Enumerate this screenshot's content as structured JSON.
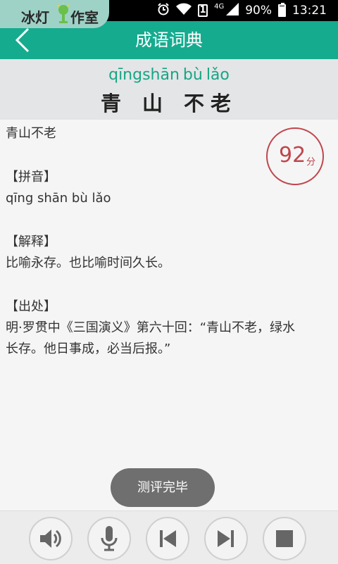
{
  "statusbar": {
    "watermark_left": "冰灯",
    "watermark_right": "作室",
    "network": "4G",
    "sim": "1",
    "battery": "90%",
    "time": "13:21"
  },
  "header": {
    "title": "成语词典"
  },
  "idiom": {
    "pinyin": "qīngshān bù lǎo",
    "chars_first": "青山",
    "chars_rest": "不老"
  },
  "content": {
    "word": "青山不老",
    "pinyin_heading": "【拼音】",
    "pinyin_text": "qīng shān bù lǎo",
    "meaning_heading": "【解释】",
    "meaning_text": "比喻永存。也比喻时间久长。",
    "source_heading": "【出处】",
    "source_line1": "明·罗贯中《三国演义》第六十回：“青山不老，绿水",
    "source_line2": "长存。他日事成，必当后报。”"
  },
  "score": {
    "value": "92",
    "unit": "分",
    "color": "#c0464d"
  },
  "toast": {
    "text": "测评完毕"
  },
  "controls": [
    "speaker-icon",
    "microphone-icon",
    "previous-icon",
    "next-icon",
    "stop-icon"
  ],
  "colors": {
    "accent": "#15ab8f",
    "banner": "#e3e5e6"
  }
}
